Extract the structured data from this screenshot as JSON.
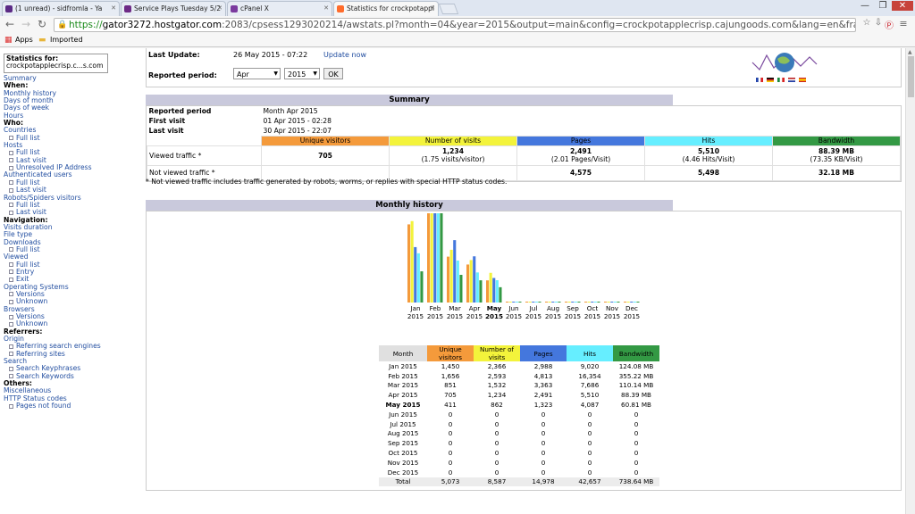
{
  "browser": {
    "tabs": [
      {
        "label": "(1 unread) - sidfromla - Ya",
        "icon_color": "#5b2a85"
      },
      {
        "label": "Service Plays Tuesday 5/2",
        "icon_color": "#6e2a86"
      },
      {
        "label": "cPanel X",
        "icon_color": "#7b3a9e"
      },
      {
        "label": "Statistics for crockpotappl",
        "icon_color": "#ff6c2c"
      }
    ],
    "url_https": "https://",
    "url_host": "gator3272.hostgator.com",
    "url_rest": ":2083/cpsess1293020214/awstats.pl?month=04&year=2015&output=main&config=crockpotapplecrisp.cajungoods.com&lang=en&framename=index",
    "bookmarks": [
      "Apps",
      "Imported"
    ]
  },
  "sidebar": {
    "stats_for": "Statistics for:",
    "site": "crockpotapplecrisp.c...s.com",
    "items": [
      {
        "t": "Summary",
        "c": "l"
      },
      {
        "t": "When:",
        "c": "h"
      },
      {
        "t": "Monthly history",
        "c": "l"
      },
      {
        "t": "Days of month",
        "c": "l"
      },
      {
        "t": "Days of week",
        "c": "l"
      },
      {
        "t": "Hours",
        "c": "l"
      },
      {
        "t": "Who:",
        "c": "h"
      },
      {
        "t": "Countries",
        "c": "l"
      },
      {
        "t": "Full list",
        "c": "s"
      },
      {
        "t": "Hosts",
        "c": "l"
      },
      {
        "t": "Full list",
        "c": "s"
      },
      {
        "t": "Last visit",
        "c": "s"
      },
      {
        "t": "Unresolved IP Address",
        "c": "s"
      },
      {
        "t": "Authenticated users",
        "c": "l"
      },
      {
        "t": "Full list",
        "c": "s"
      },
      {
        "t": "Last visit",
        "c": "s"
      },
      {
        "t": "Robots/Spiders visitors",
        "c": "l"
      },
      {
        "t": "Full list",
        "c": "s"
      },
      {
        "t": "Last visit",
        "c": "s"
      },
      {
        "t": "Navigation:",
        "c": "h"
      },
      {
        "t": "Visits duration",
        "c": "l"
      },
      {
        "t": "File type",
        "c": "l"
      },
      {
        "t": "Downloads",
        "c": "l"
      },
      {
        "t": "Full list",
        "c": "s"
      },
      {
        "t": "Viewed",
        "c": "l"
      },
      {
        "t": "Full list",
        "c": "s"
      },
      {
        "t": "Entry",
        "c": "s"
      },
      {
        "t": "Exit",
        "c": "s"
      },
      {
        "t": "Operating Systems",
        "c": "l"
      },
      {
        "t": "Versions",
        "c": "s"
      },
      {
        "t": "Unknown",
        "c": "s"
      },
      {
        "t": "Browsers",
        "c": "l"
      },
      {
        "t": "Versions",
        "c": "s"
      },
      {
        "t": "Unknown",
        "c": "s"
      },
      {
        "t": "Referrers:",
        "c": "h"
      },
      {
        "t": "Origin",
        "c": "l"
      },
      {
        "t": "Referring search engines",
        "c": "s"
      },
      {
        "t": "Referring sites",
        "c": "s"
      },
      {
        "t": "Search",
        "c": "l"
      },
      {
        "t": "Search Keyphrases",
        "c": "s"
      },
      {
        "t": "Search Keywords",
        "c": "s"
      },
      {
        "t": "Others:",
        "c": "h"
      },
      {
        "t": "Miscellaneous",
        "c": "l"
      },
      {
        "t": "HTTP Status codes",
        "c": "l"
      },
      {
        "t": "Pages not found",
        "c": "s"
      }
    ]
  },
  "top": {
    "last_update_label": "Last Update:",
    "last_update_value": "26 May 2015 - 07:22",
    "update_now": "Update now",
    "reported_period_label": "Reported period:",
    "month_value": "Apr",
    "year_value": "2015",
    "ok": "OK"
  },
  "summary": {
    "title": "Summary",
    "reported_period_label": "Reported period",
    "reported_period_value": "Month Apr 2015",
    "first_visit_label": "First visit",
    "first_visit_value": "01 Apr 2015 - 02:28",
    "last_visit_label": "Last visit",
    "last_visit_value": "30 Apr 2015 - 22:07",
    "columns": [
      {
        "label": "Unique visitors",
        "color": "#f49a3b"
      },
      {
        "label": "Number of visits",
        "color": "#f3f33b"
      },
      {
        "label": "Pages",
        "color": "#4477dd"
      },
      {
        "label": "Hits",
        "color": "#66eeff"
      },
      {
        "label": "Bandwidth",
        "color": "#339944"
      }
    ],
    "viewed_label": "Viewed traffic *",
    "viewed": [
      {
        "main": "705",
        "sub": ""
      },
      {
        "main": "1,234",
        "sub": "(1.75 visits/visitor)"
      },
      {
        "main": "2,491",
        "sub": "(2.01 Pages/Visit)"
      },
      {
        "main": "5,510",
        "sub": "(4.46 Hits/Visit)"
      },
      {
        "main": "88.39 MB",
        "sub": "(73.35 KB/Visit)"
      }
    ],
    "not_viewed_label": "Not viewed traffic *",
    "not_viewed": [
      "",
      "",
      "4,575",
      "5,498",
      "32.18 MB"
    ],
    "note": "* Not viewed traffic includes traffic generated by robots, worms, or replies with special HTTP status codes."
  },
  "monthly": {
    "title": "Monthly history",
    "months": [
      "Jan",
      "Feb",
      "Mar",
      "Apr",
      "May",
      "Jun",
      "Jul",
      "Aug",
      "Sep",
      "Oct",
      "Nov",
      "Dec"
    ],
    "year": "2015",
    "current_month_index": 4
  },
  "chart_data": {
    "type": "bar",
    "categories": [
      "Jan 2015",
      "Feb 2015",
      "Mar 2015",
      "Apr 2015",
      "May 2015",
      "Jun 2015",
      "Jul 2015",
      "Aug 2015",
      "Sep 2015",
      "Oct 2015",
      "Nov 2015",
      "Dec 2015"
    ],
    "series": [
      {
        "name": "Unique visitors",
        "color": "#f49a3b",
        "values": [
          1450,
          1656,
          851,
          705,
          411,
          0,
          0,
          0,
          0,
          0,
          0,
          0
        ]
      },
      {
        "name": "Number of visits",
        "color": "#f3f33b",
        "values": [
          2366,
          2593,
          1532,
          1234,
          862,
          0,
          0,
          0,
          0,
          0,
          0,
          0
        ]
      },
      {
        "name": "Pages",
        "color": "#4477dd",
        "values": [
          2988,
          4813,
          3363,
          2491,
          1323,
          0,
          0,
          0,
          0,
          0,
          0,
          0
        ]
      },
      {
        "name": "Hits",
        "color": "#66eeff",
        "values": [
          9020,
          16354,
          7686,
          5510,
          4087,
          0,
          0,
          0,
          0,
          0,
          0,
          0
        ]
      },
      {
        "name": "Bandwidth",
        "color": "#339944",
        "values": [
          124.08,
          355.22,
          110.14,
          88.39,
          60.81,
          0,
          0,
          0,
          0,
          0,
          0,
          0
        ]
      }
    ]
  },
  "table": {
    "headers": [
      "Month",
      "Unique visitors",
      "Number of visits",
      "Pages",
      "Hits",
      "Bandwidth"
    ],
    "rows": [
      [
        "Jan 2015",
        "1,450",
        "2,366",
        "2,988",
        "9,020",
        "124.08 MB"
      ],
      [
        "Feb 2015",
        "1,656",
        "2,593",
        "4,813",
        "16,354",
        "355.22 MB"
      ],
      [
        "Mar 2015",
        "851",
        "1,532",
        "3,363",
        "7,686",
        "110.14 MB"
      ],
      [
        "Apr 2015",
        "705",
        "1,234",
        "2,491",
        "5,510",
        "88.39 MB"
      ],
      [
        "May 2015",
        "411",
        "862",
        "1,323",
        "4,087",
        "60.81 MB"
      ],
      [
        "Jun 2015",
        "0",
        "0",
        "0",
        "0",
        "0"
      ],
      [
        "Jul 2015",
        "0",
        "0",
        "0",
        "0",
        "0"
      ],
      [
        "Aug 2015",
        "0",
        "0",
        "0",
        "0",
        "0"
      ],
      [
        "Sep 2015",
        "0",
        "0",
        "0",
        "0",
        "0"
      ],
      [
        "Oct 2015",
        "0",
        "0",
        "0",
        "0",
        "0"
      ],
      [
        "Nov 2015",
        "0",
        "0",
        "0",
        "0",
        "0"
      ],
      [
        "Dec 2015",
        "0",
        "0",
        "0",
        "0",
        "0"
      ]
    ],
    "total": [
      "Total",
      "5,073",
      "8,587",
      "14,978",
      "42,657",
      "738.64 MB"
    ]
  }
}
